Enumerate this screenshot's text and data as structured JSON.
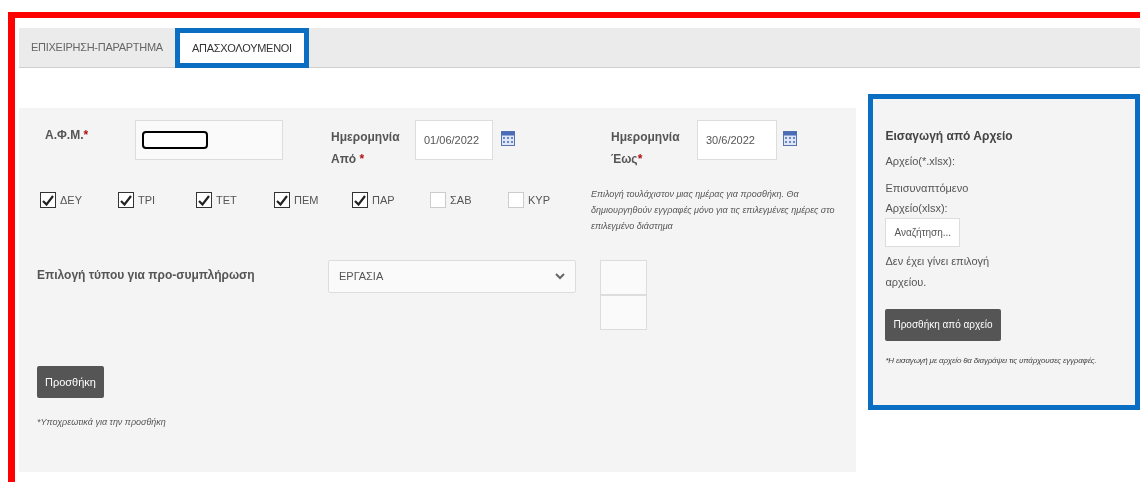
{
  "tabs": [
    {
      "label": "ΕΠΙΧΕΙΡΗΣΗ-ΠΑΡΑΡΤΗΜΑ",
      "selected": false
    },
    {
      "label": "ΑΠΑΣΧΟΛΟΥΜΕΝΟΙ",
      "selected": true
    }
  ],
  "form": {
    "afm": {
      "label": "Α.Φ.Μ.",
      "marker": "*"
    },
    "date_from": {
      "label": "Ημερομηνία Από",
      "marker": "*",
      "value": "01/06/2022"
    },
    "date_to": {
      "label": "Ημερομηνία Έως",
      "marker": "*",
      "value": "30/6/2022"
    },
    "days": [
      {
        "label": "ΔΕΥ",
        "checked": true
      },
      {
        "label": "ΤΡΙ",
        "checked": true
      },
      {
        "label": "ΤΕΤ",
        "checked": true
      },
      {
        "label": "ΠΕΜ",
        "checked": true
      },
      {
        "label": "ΠΑΡ",
        "checked": true
      },
      {
        "label": "ΣΑΒ",
        "checked": false
      },
      {
        "label": "ΚΥΡ",
        "checked": false
      }
    ],
    "days_note": "Επιλογή τουλάχιστον μιας ημέρας για προσθήκη. Θα δημιουργηθούν εγγραφές μόνο για τις επιλεγμένες ημέρες στο επιλεγμένο διάστημα",
    "type": {
      "label": "Επιλογή τύπου για προ-συμπλήρωση",
      "value": "ΕΡΓΑΣΙΑ"
    },
    "add_button": "Προσθήκη",
    "footnote": "*Υποχρεωτικά για την προσθήκη"
  },
  "import_panel": {
    "title": "Εισαγωγή από Αρχείο",
    "file_label": "Αρχείο(*.xlsx):",
    "attached_label": "Επισυναπτόμενο Αρχείο(xlsx):",
    "browse_button": "Αναζήτηση...",
    "no_file": "Δεν έχει γίνει επιλογή αρχείου.",
    "add_button": "Προσθήκη από αρχείο",
    "warning": "*Η εισαγωγή με αρχείο θα διαγράψει τις υπάρχουσες εγγραφές."
  }
}
